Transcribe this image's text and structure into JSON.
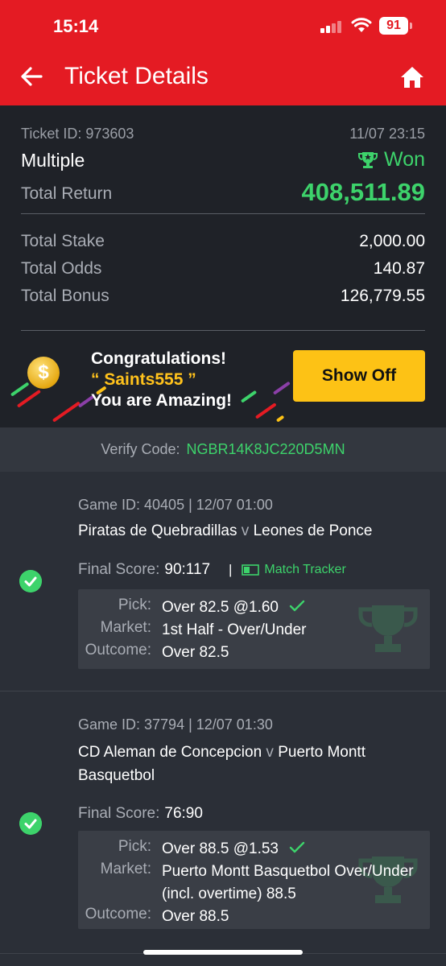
{
  "status_bar": {
    "time": "15:14",
    "battery": "91"
  },
  "header": {
    "title": "Ticket Details"
  },
  "ticket": {
    "id_label": "Ticket ID: 973603",
    "datetime": "11/07 23:15",
    "bet_type": "Multiple",
    "status": "Won",
    "total_return_label": "Total Return",
    "total_return": "408,511.89",
    "total_stake_label": "Total Stake",
    "total_stake": "2,000.00",
    "total_odds_label": "Total Odds",
    "total_odds": "140.87",
    "total_bonus_label": "Total Bonus",
    "total_bonus": "126,779.55"
  },
  "banner": {
    "line1": "Congratulations!",
    "username": "“ Saints555 ”",
    "line3": "You are Amazing!",
    "button": "Show Off"
  },
  "verify": {
    "label": "Verify Code:",
    "code": "NGBR14K8JC220D5MN"
  },
  "games": [
    {
      "game_id": "Game ID: 40405 | 12/07 01:00",
      "home": "Piratas de Quebradillas",
      "away": "Leones de Ponce",
      "final_score_label": "Final Score:",
      "final_score": "90:117",
      "match_tracker": "Match Tracker",
      "pick_label": "Pick:",
      "pick": "Over 82.5 @1.60",
      "market_label": "Market:",
      "market": "1st Half - Over/Under",
      "outcome_label": "Outcome:",
      "outcome": "Over 82.5"
    },
    {
      "game_id": "Game ID: 37794 | 12/07 01:30",
      "home": "CD Aleman de Concepcion",
      "away": "Puerto Montt Basquetbol",
      "final_score_label": "Final Score:",
      "final_score": "76:90",
      "pick_label": "Pick:",
      "pick": "Over 88.5 @1.53",
      "market_label": "Market:",
      "market": "Puerto Montt Basquetbol Over/Under (incl. overtime) 88.5",
      "outcome_label": "Outcome:",
      "outcome": "Over 88.5"
    }
  ],
  "colors": {
    "brand_red": "#e41b23",
    "win_green": "#3dd36b",
    "gold": "#fdc215"
  }
}
